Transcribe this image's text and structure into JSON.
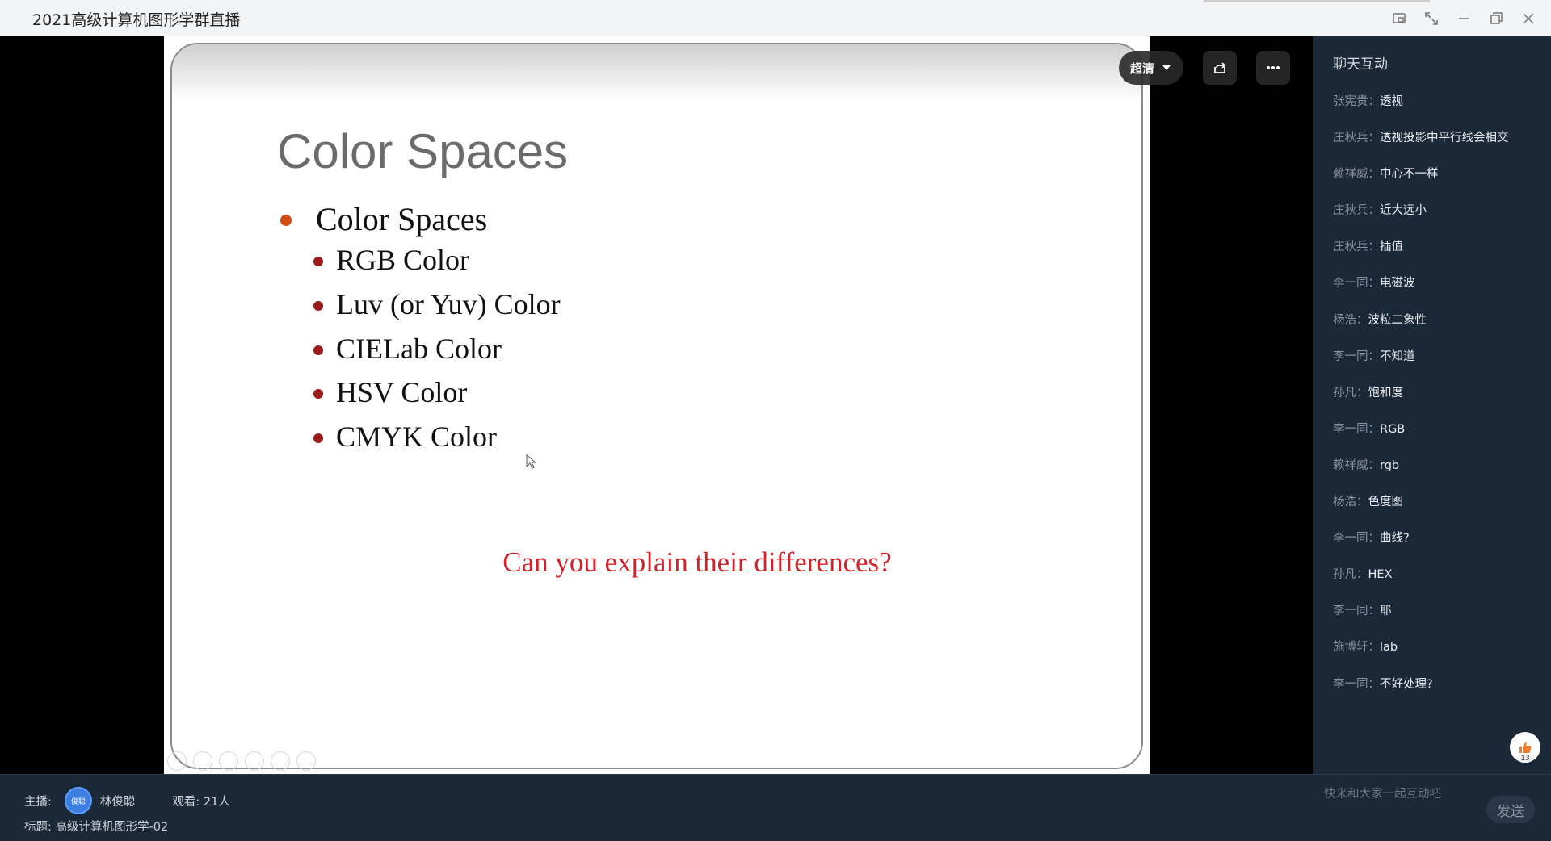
{
  "window": {
    "title": "2021高级计算机图形学群直播"
  },
  "player": {
    "quality_label": "超清"
  },
  "slide": {
    "title": "Color Spaces",
    "bullet": "Color Spaces",
    "sub_bullets": [
      "RGB Color",
      "Luv (or Yuv) Color",
      "CIELab Color",
      "HSV Color",
      "CMYK Color"
    ],
    "question": "Can you explain their differences?",
    "colors": {
      "title": "#6b6b6b",
      "bullet_dot": "#d14b16",
      "sub_dot": "#9b1c1c",
      "question": "#d2232a"
    }
  },
  "chat": {
    "header": "聊天互动",
    "separator": "：",
    "messages": [
      {
        "name": "张宪贵",
        "text": "透视"
      },
      {
        "name": "庄秋兵",
        "text": "透视投影中平行线会相交"
      },
      {
        "name": "赖祥威",
        "text": "中心不一样"
      },
      {
        "name": "庄秋兵",
        "text": "近大远小"
      },
      {
        "name": "庄秋兵",
        "text": "插值"
      },
      {
        "name": "李一同",
        "text": "电磁波"
      },
      {
        "name": "杨浩",
        "text": "波粒二象性"
      },
      {
        "name": "李一同",
        "text": "不知道"
      },
      {
        "name": "孙凡",
        "text": "饱和度"
      },
      {
        "name": "李一同",
        "text": "RGB"
      },
      {
        "name": "赖祥威",
        "text": "rgb"
      },
      {
        "name": "杨浩",
        "text": "色度图"
      },
      {
        "name": "李一同",
        "text": "曲线?"
      },
      {
        "name": "孙凡",
        "text": "HEX"
      },
      {
        "name": "李一同",
        "text": "耶"
      },
      {
        "name": "施博轩",
        "text": "lab"
      },
      {
        "name": "李一同",
        "text": "不好处理?"
      }
    ],
    "like_count": "13",
    "input_placeholder": "快来和大家一起互动吧",
    "send_label": "发送"
  },
  "footer": {
    "host_label": "主播:",
    "host_avatar_text": "俊聪",
    "host_name": "林俊聪",
    "viewers_label": "观看: 21人",
    "topic_label": "标题: 高级计算机图形学-02"
  }
}
